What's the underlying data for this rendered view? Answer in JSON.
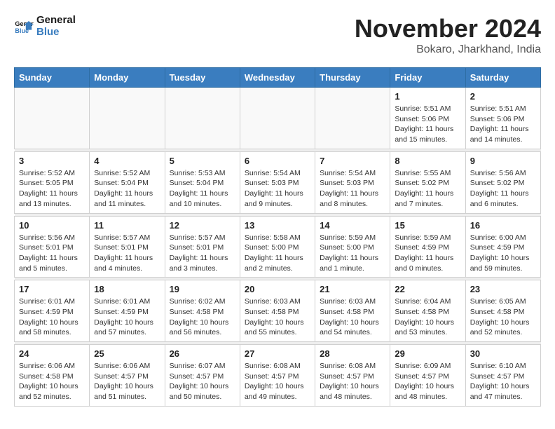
{
  "logo": {
    "line1": "General",
    "line2": "Blue"
  },
  "title": "November 2024",
  "location": "Bokaro, Jharkhand, India",
  "weekdays": [
    "Sunday",
    "Monday",
    "Tuesday",
    "Wednesday",
    "Thursday",
    "Friday",
    "Saturday"
  ],
  "weeks": [
    [
      {
        "day": "",
        "info": ""
      },
      {
        "day": "",
        "info": ""
      },
      {
        "day": "",
        "info": ""
      },
      {
        "day": "",
        "info": ""
      },
      {
        "day": "",
        "info": ""
      },
      {
        "day": "1",
        "info": "Sunrise: 5:51 AM\nSunset: 5:06 PM\nDaylight: 11 hours and 15 minutes."
      },
      {
        "day": "2",
        "info": "Sunrise: 5:51 AM\nSunset: 5:06 PM\nDaylight: 11 hours and 14 minutes."
      }
    ],
    [
      {
        "day": "3",
        "info": "Sunrise: 5:52 AM\nSunset: 5:05 PM\nDaylight: 11 hours and 13 minutes."
      },
      {
        "day": "4",
        "info": "Sunrise: 5:52 AM\nSunset: 5:04 PM\nDaylight: 11 hours and 11 minutes."
      },
      {
        "day": "5",
        "info": "Sunrise: 5:53 AM\nSunset: 5:04 PM\nDaylight: 11 hours and 10 minutes."
      },
      {
        "day": "6",
        "info": "Sunrise: 5:54 AM\nSunset: 5:03 PM\nDaylight: 11 hours and 9 minutes."
      },
      {
        "day": "7",
        "info": "Sunrise: 5:54 AM\nSunset: 5:03 PM\nDaylight: 11 hours and 8 minutes."
      },
      {
        "day": "8",
        "info": "Sunrise: 5:55 AM\nSunset: 5:02 PM\nDaylight: 11 hours and 7 minutes."
      },
      {
        "day": "9",
        "info": "Sunrise: 5:56 AM\nSunset: 5:02 PM\nDaylight: 11 hours and 6 minutes."
      }
    ],
    [
      {
        "day": "10",
        "info": "Sunrise: 5:56 AM\nSunset: 5:01 PM\nDaylight: 11 hours and 5 minutes."
      },
      {
        "day": "11",
        "info": "Sunrise: 5:57 AM\nSunset: 5:01 PM\nDaylight: 11 hours and 4 minutes."
      },
      {
        "day": "12",
        "info": "Sunrise: 5:57 AM\nSunset: 5:01 PM\nDaylight: 11 hours and 3 minutes."
      },
      {
        "day": "13",
        "info": "Sunrise: 5:58 AM\nSunset: 5:00 PM\nDaylight: 11 hours and 2 minutes."
      },
      {
        "day": "14",
        "info": "Sunrise: 5:59 AM\nSunset: 5:00 PM\nDaylight: 11 hours and 1 minute."
      },
      {
        "day": "15",
        "info": "Sunrise: 5:59 AM\nSunset: 4:59 PM\nDaylight: 11 hours and 0 minutes."
      },
      {
        "day": "16",
        "info": "Sunrise: 6:00 AM\nSunset: 4:59 PM\nDaylight: 10 hours and 59 minutes."
      }
    ],
    [
      {
        "day": "17",
        "info": "Sunrise: 6:01 AM\nSunset: 4:59 PM\nDaylight: 10 hours and 58 minutes."
      },
      {
        "day": "18",
        "info": "Sunrise: 6:01 AM\nSunset: 4:59 PM\nDaylight: 10 hours and 57 minutes."
      },
      {
        "day": "19",
        "info": "Sunrise: 6:02 AM\nSunset: 4:58 PM\nDaylight: 10 hours and 56 minutes."
      },
      {
        "day": "20",
        "info": "Sunrise: 6:03 AM\nSunset: 4:58 PM\nDaylight: 10 hours and 55 minutes."
      },
      {
        "day": "21",
        "info": "Sunrise: 6:03 AM\nSunset: 4:58 PM\nDaylight: 10 hours and 54 minutes."
      },
      {
        "day": "22",
        "info": "Sunrise: 6:04 AM\nSunset: 4:58 PM\nDaylight: 10 hours and 53 minutes."
      },
      {
        "day": "23",
        "info": "Sunrise: 6:05 AM\nSunset: 4:58 PM\nDaylight: 10 hours and 52 minutes."
      }
    ],
    [
      {
        "day": "24",
        "info": "Sunrise: 6:06 AM\nSunset: 4:58 PM\nDaylight: 10 hours and 52 minutes."
      },
      {
        "day": "25",
        "info": "Sunrise: 6:06 AM\nSunset: 4:57 PM\nDaylight: 10 hours and 51 minutes."
      },
      {
        "day": "26",
        "info": "Sunrise: 6:07 AM\nSunset: 4:57 PM\nDaylight: 10 hours and 50 minutes."
      },
      {
        "day": "27",
        "info": "Sunrise: 6:08 AM\nSunset: 4:57 PM\nDaylight: 10 hours and 49 minutes."
      },
      {
        "day": "28",
        "info": "Sunrise: 6:08 AM\nSunset: 4:57 PM\nDaylight: 10 hours and 48 minutes."
      },
      {
        "day": "29",
        "info": "Sunrise: 6:09 AM\nSunset: 4:57 PM\nDaylight: 10 hours and 48 minutes."
      },
      {
        "day": "30",
        "info": "Sunrise: 6:10 AM\nSunset: 4:57 PM\nDaylight: 10 hours and 47 minutes."
      }
    ]
  ]
}
